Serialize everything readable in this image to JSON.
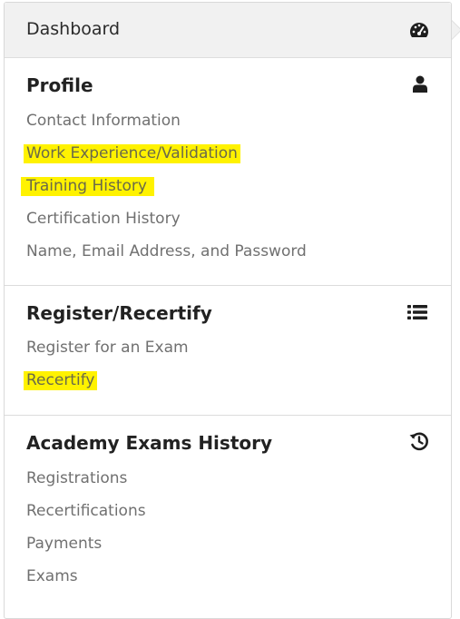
{
  "dashboard": {
    "label": "Dashboard",
    "icon": "dashboard-gauge-icon"
  },
  "sections": {
    "profile": {
      "title": "Profile",
      "icon": "user-icon",
      "items": [
        {
          "label": "Contact Information",
          "highlighted": false
        },
        {
          "label": "Work Experience/Validation",
          "highlighted": true
        },
        {
          "label": "Training History",
          "highlighted": true
        },
        {
          "label": "Certification History",
          "highlighted": false
        },
        {
          "label": "Name, Email Address, and Password",
          "highlighted": false
        }
      ]
    },
    "register": {
      "title": "Register/Recertify",
      "icon": "list-icon",
      "items": [
        {
          "label": "Register for an Exam",
          "highlighted": false
        },
        {
          "label": "Recertify",
          "highlighted": true
        }
      ]
    },
    "academy": {
      "title": "Academy Exams History",
      "icon": "history-icon",
      "items": [
        {
          "label": "Registrations",
          "highlighted": false
        },
        {
          "label": "Recertifications",
          "highlighted": false
        },
        {
          "label": "Payments",
          "highlighted": false
        },
        {
          "label": "Exams",
          "highlighted": false
        }
      ]
    }
  },
  "colors": {
    "highlight": "#fff200",
    "link": "#707070",
    "title": "#222222",
    "header_bg": "#f1f1f1"
  }
}
